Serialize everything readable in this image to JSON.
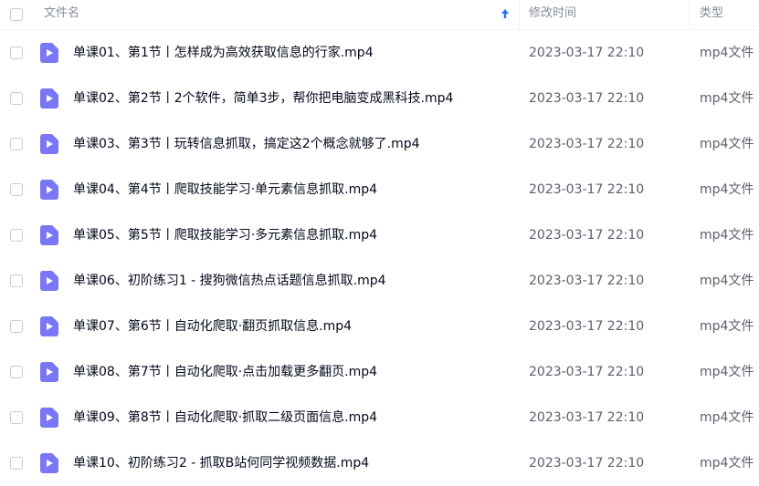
{
  "header": {
    "name_label": "文件名",
    "time_label": "修改时间",
    "type_label": "类型",
    "sort_icon": "arrow-up-icon",
    "accent_color": "#1e6fff"
  },
  "file_icon": {
    "icon": "video-file-icon",
    "color": "#7a77f7"
  },
  "files": [
    {
      "name": "单课01、第1节丨怎样成为高效获取信息的行家.mp4",
      "modified": "2023-03-17 22:10",
      "type": "mp4文件"
    },
    {
      "name": "单课02、第2节丨2个软件，简单3步，帮你把电脑变成黑科技.mp4",
      "modified": "2023-03-17 22:10",
      "type": "mp4文件"
    },
    {
      "name": "单课03、第3节丨玩转信息抓取，搞定这2个概念就够了.mp4",
      "modified": "2023-03-17 22:10",
      "type": "mp4文件"
    },
    {
      "name": "单课04、第4节丨爬取技能学习·单元素信息抓取.mp4",
      "modified": "2023-03-17 22:10",
      "type": "mp4文件"
    },
    {
      "name": "单课05、第5节丨爬取技能学习·多元素信息抓取.mp4",
      "modified": "2023-03-17 22:10",
      "type": "mp4文件"
    },
    {
      "name": "单课06、初阶练习1 - 搜狗微信热点话题信息抓取.mp4",
      "modified": "2023-03-17 22:10",
      "type": "mp4文件"
    },
    {
      "name": "单课07、第6节丨自动化爬取·翻页抓取信息.mp4",
      "modified": "2023-03-17 22:10",
      "type": "mp4文件"
    },
    {
      "name": "单课08、第7节丨自动化爬取·点击加载更多翻页.mp4",
      "modified": "2023-03-17 22:10",
      "type": "mp4文件"
    },
    {
      "name": "单课09、第8节丨自动化爬取·抓取二级页面信息.mp4",
      "modified": "2023-03-17 22:10",
      "type": "mp4文件"
    },
    {
      "name": "单课10、初阶练习2 - 抓取B站何同学视频数据.mp4",
      "modified": "2023-03-17 22:10",
      "type": "mp4文件"
    }
  ]
}
